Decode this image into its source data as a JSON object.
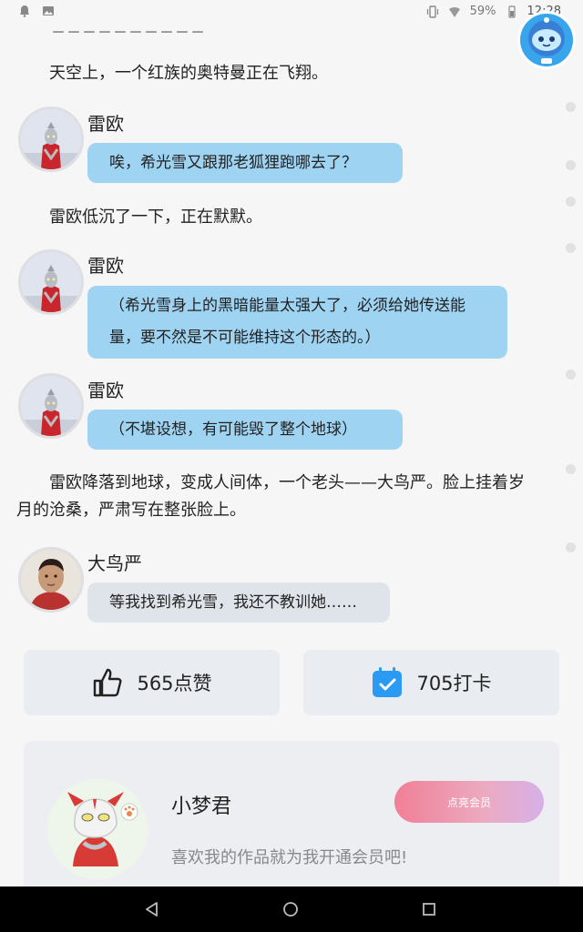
{
  "status_bar": {
    "battery": "59%",
    "time": "12:28",
    "left_icons": [
      "notification-icon",
      "image-icon"
    ],
    "right_icons": [
      "vibrate-icon",
      "signal-icon",
      "battery-icon"
    ]
  },
  "story": {
    "divider_text": "－－－－－－－－－－",
    "lines": [
      {
        "type": "narration",
        "text": "天空上，一个红族的奥特曼正在飞翔。"
      },
      {
        "type": "dialogue",
        "speaker": "雷欧",
        "text": "唉，希光雪又跟那老狐狸跑哪去了？"
      },
      {
        "type": "narration",
        "text": "雷欧低沉了一下，正在默默。"
      },
      {
        "type": "dialogue",
        "speaker": "雷欧",
        "text": "（希光雪身上的黑暗能量太强大了，必须给她传送能量，要不然是不可能维持这个形态的。）"
      },
      {
        "type": "dialogue",
        "speaker": "雷欧",
        "text": "（不堪设想，有可能毁了整个地球）"
      },
      {
        "type": "narration",
        "text": "雷欧降落到地球，变成人间体，一个老头——大鸟严。脸上挂着岁月的沧桑，严肃写在整张脸上。"
      },
      {
        "type": "dialogue",
        "speaker": "大鸟严",
        "text": "等我找到希光雪，我还不教训她……"
      }
    ]
  },
  "actions": {
    "like_label": "565点赞",
    "checkin_label": "705打卡"
  },
  "author": {
    "name": "小梦君",
    "description": "喜欢我的作品就为我开通会员吧!",
    "member_button": "点亮会员"
  },
  "colors": {
    "bubble_blue": "#9fd3f2",
    "bubble_grey": "#dfe3ea",
    "checkin_blue": "#2b9af3",
    "member_gradient_start": "#f07f96",
    "member_gradient_end": "#d7b0e8"
  },
  "nav": {
    "icons": [
      "back-icon",
      "home-icon",
      "recents-icon"
    ]
  }
}
